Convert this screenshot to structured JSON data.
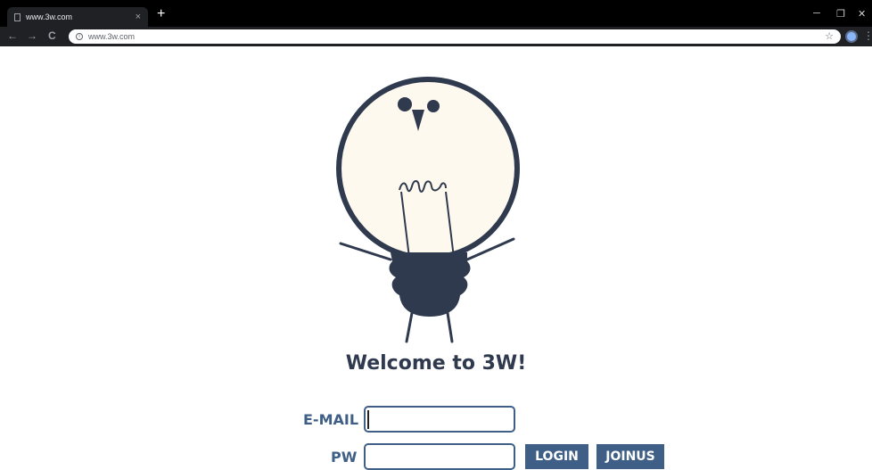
{
  "browser": {
    "tab_title": "www.3w.com",
    "tab_close": "×",
    "new_tab": "+",
    "url": "www.3w.com",
    "minimize": "─",
    "restore": "❐",
    "close": "✕",
    "back": "←",
    "forward": "→",
    "reload": "C",
    "star": "☆",
    "menu": "⋮"
  },
  "page": {
    "welcome": "Welcome to 3W!",
    "email_label": "E-MAIL",
    "email_value": "",
    "pw_label": "PW",
    "pw_value": "",
    "login_label": "LOGIN",
    "join_label": "JOINUS"
  },
  "colors": {
    "accent": "#3f5f87",
    "bulb_fill": "#fdf9ee",
    "outline": "#2f3a4e"
  }
}
